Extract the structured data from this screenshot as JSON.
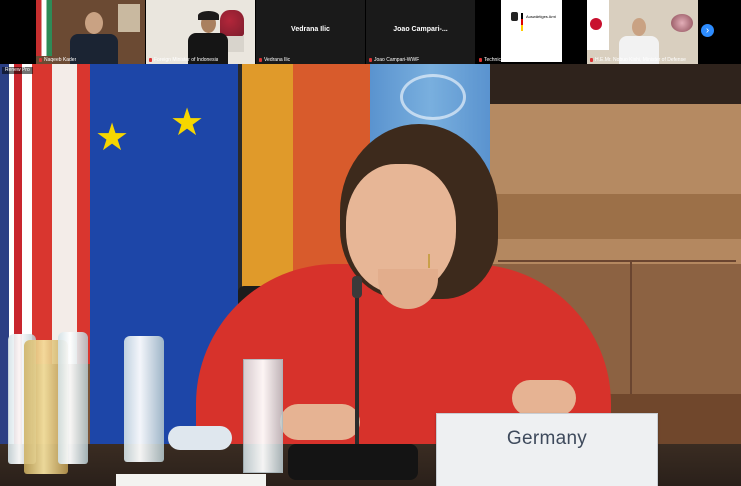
{
  "participants": [
    {
      "name": "Naqeeb Kader",
      "type": "video"
    },
    {
      "name": "Foreign Minister of Indonesia",
      "type": "video"
    },
    {
      "name": "Vedrana Ilic",
      "display_name": "Vedrana Ilic",
      "type": "name-only"
    },
    {
      "name": "Joao Campari-WWF",
      "display_name": "Joao Campari-...",
      "type": "name-only"
    },
    {
      "name": "Technical",
      "type": "logo",
      "logo_text": "Auswärtiges Amt"
    },
    {
      "name": "H.E.Mr. Nobuo Kishi, Minister of Defense",
      "type": "video"
    }
  ],
  "main_speaker": {
    "name": "Renew Pro",
    "nameplate": "Germany"
  },
  "controls": {
    "next_page_icon": "chevron-right-icon"
  },
  "colors": {
    "accent": "#2d8cff",
    "top_bar": "#000000",
    "jacket": "#d7322b"
  }
}
